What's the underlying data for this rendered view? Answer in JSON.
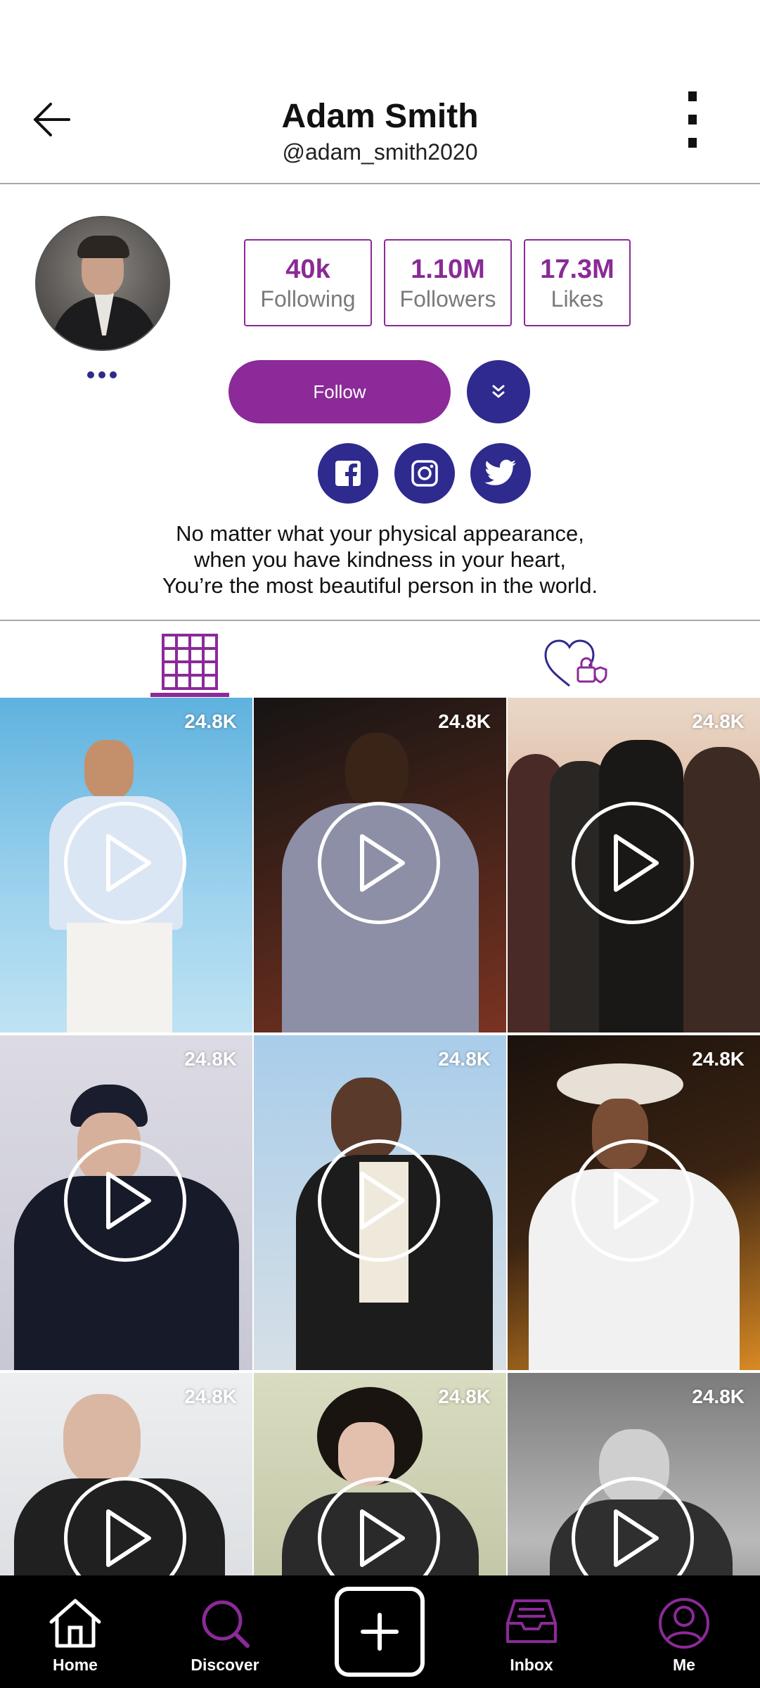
{
  "header": {
    "title": "Adam Smith",
    "handle": "@adam_smith2020",
    "back_icon": "arrow-left-icon",
    "more_icon": "more-vertical-icon"
  },
  "profile": {
    "stats": {
      "following": {
        "value": "40k",
        "label": "Following"
      },
      "followers": {
        "value": "1.10M",
        "label": "Followers"
      },
      "likes": {
        "value": "17.3M",
        "label": "Likes"
      }
    },
    "follow_label": "Follow",
    "bio": [
      "No matter what your physical appearance,",
      "when you have kindness in your heart,",
      "You’re the most beautiful person in the world."
    ],
    "social": [
      "facebook-icon",
      "instagram-icon",
      "twitter-icon"
    ]
  },
  "tabs": [
    "grid-icon",
    "liked-private-icon"
  ],
  "videos": [
    {
      "views": "24.8K"
    },
    {
      "views": "24.8K"
    },
    {
      "views": "24.8K"
    },
    {
      "views": "24.8K"
    },
    {
      "views": "24.8K"
    },
    {
      "views": "24.8K"
    },
    {
      "views": "24.8K"
    },
    {
      "views": "24.8K"
    },
    {
      "views": "24.8K"
    }
  ],
  "nav": {
    "home": "Home",
    "discover": "Discover",
    "inbox": "Inbox",
    "me": "Me"
  },
  "colors": {
    "accent_purple": "#8b2a98",
    "accent_navy": "#2e2a8e",
    "nav_background": "#000000"
  }
}
